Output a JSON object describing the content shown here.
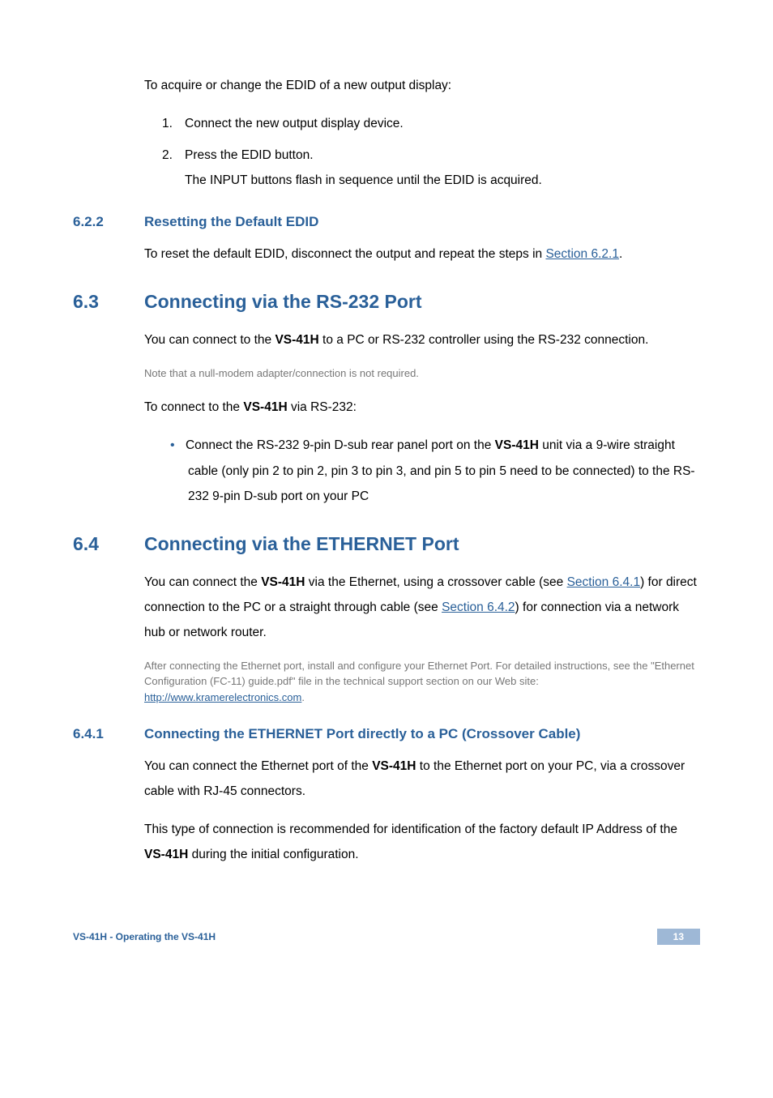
{
  "intro": "To acquire or change the EDID of a new output display:",
  "ol1_num": "1.",
  "ol1_text": "Connect the new output display device.",
  "ol2_num": "2.",
  "ol2_text": "Press the EDID button.",
  "ol2_sub": "The INPUT buttons flash in sequence until the EDID is acquired.",
  "s622_num": "6.2.2",
  "s622_title": "Resetting the Default EDID",
  "s622_body_pre": "To reset the default EDID, disconnect the output and repeat the steps in ",
  "s622_link": "Section 6.2.1",
  "s622_body_post": ".",
  "s63_num": "6.3",
  "s63_title": "Connecting via the RS-232 Port",
  "s63_p1_pre": "You can connect to the ",
  "s63_p1_bold": "VS-41H",
  "s63_p1_post": " to a PC or RS-232 controller using the RS-232 connection.",
  "s63_note": "Note that a null-modem adapter/connection is not required.",
  "s63_p2_pre": "To connect to the ",
  "s63_p2_bold": "VS-41H",
  "s63_p2_post": " via RS-232:",
  "s63_bullet_pre": "Connect the RS-232 9-pin D-sub rear panel port on the ",
  "s63_bullet_bold": "VS-41H",
  "s63_bullet_post": " unit via a 9-wire straight cable (only pin 2 to pin 2, pin 3 to pin 3, and pin 5 to pin 5 need to be connected) to the RS-232 9-pin D-sub port on your PC",
  "s64_num": "6.4",
  "s64_title": "Connecting via the ETHERNET Port",
  "s64_p1_pre": "You can connect the ",
  "s64_p1_bold": "VS-41H",
  "s64_p1_mid1": " via the Ethernet, using a crossover cable (see ",
  "s64_link1": "Section 6.4.1",
  "s64_p1_mid2": ") for direct connection to the PC or a straight through cable (see ",
  "s64_link2": "Section 6.4.2",
  "s64_p1_post": ") for connection via a network hub or network router.",
  "s64_note_pre": "After connecting the Ethernet port, install and configure your Ethernet Port. For detailed instructions, see the \"Ethernet Configuration (FC-11) guide.pdf\" file in the technical support section on our Web site: ",
  "s64_note_link": "http://www.kramerelectronics.com",
  "s64_note_post": ".",
  "s641_num": "6.4.1",
  "s641_title": "Connecting the ETHERNET Port directly to a PC (Crossover Cable)",
  "s641_p1_pre": "You can connect the Ethernet port of the ",
  "s641_p1_bold": "VS-41H",
  "s641_p1_post": " to the Ethernet port on your PC, via a crossover cable with RJ-45 connectors.",
  "s641_p2_pre": "This type of connection is recommended for identification of the factory default IP Address of the ",
  "s641_p2_bold": "VS-41H",
  "s641_p2_post": " during the initial configuration.",
  "footer_left": "VS-41H - Operating the VS-41H",
  "footer_right": "13"
}
